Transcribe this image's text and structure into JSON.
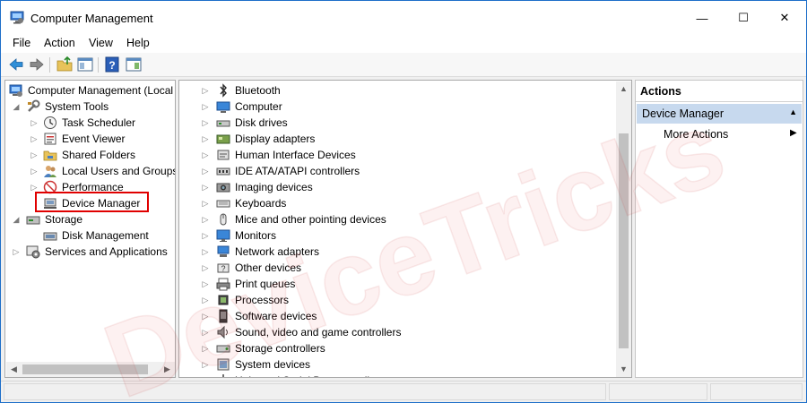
{
  "window": {
    "title": "Computer Management",
    "minimize_glyph": "—",
    "maximize_glyph": "☐",
    "close_glyph": "✕"
  },
  "menu": [
    "File",
    "Action",
    "View",
    "Help"
  ],
  "toolbar": {
    "icons": [
      "back-icon",
      "forward-icon",
      "up-folder-icon",
      "show-hide-tree-icon",
      "help-icon",
      "properties-icon"
    ]
  },
  "tree": {
    "root": "Computer Management (Local",
    "system_tools": "System Tools",
    "task_scheduler": "Task Scheduler",
    "event_viewer": "Event Viewer",
    "shared_folders": "Shared Folders",
    "local_users": "Local Users and Groups",
    "performance": "Performance",
    "device_manager": "Device Manager",
    "storage": "Storage",
    "disk_management": "Disk Management",
    "services": "Services and Applications"
  },
  "devices": [
    "Bluetooth",
    "Computer",
    "Disk drives",
    "Display adapters",
    "Human Interface Devices",
    "IDE ATA/ATAPI controllers",
    "Imaging devices",
    "Keyboards",
    "Mice and other pointing devices",
    "Monitors",
    "Network adapters",
    "Other devices",
    "Print queues",
    "Processors",
    "Software devices",
    "Sound, video and game controllers",
    "Storage controllers",
    "System devices",
    "Universal Serial Bus controllers"
  ],
  "actions": {
    "header": "Actions",
    "section": "Device Manager",
    "more": "More Actions"
  },
  "glyphs": {
    "collapsed": "▷",
    "expanded": "◢",
    "left": "◀",
    "right": "▶",
    "up": "▲",
    "down": "▼"
  },
  "watermark": "DeviceTricks",
  "colors": {
    "selection": "#c7d9ee",
    "highlight_box": "#e00000",
    "window_border": "#1e6fc9"
  }
}
